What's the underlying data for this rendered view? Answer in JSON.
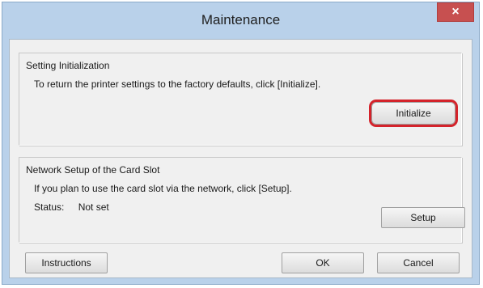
{
  "window": {
    "title": "Maintenance",
    "close_glyph": "×"
  },
  "setting_initialization": {
    "label": "Setting Initialization",
    "description": "To return the printer settings to the factory defaults, click [Initialize].",
    "initialize_button": "Initialize"
  },
  "network_setup": {
    "label": "Network Setup of the Card Slot",
    "description": "If you plan to use the card slot via the network, click [Setup].",
    "status_label": "Status:",
    "status_value": "Not set",
    "setup_button": "Setup"
  },
  "footer": {
    "instructions_button": "Instructions",
    "ok_button": "OK",
    "cancel_button": "Cancel"
  },
  "colors": {
    "highlight": "#d4232b",
    "close_button": "#c75050",
    "frame": "#b9d1ea"
  }
}
